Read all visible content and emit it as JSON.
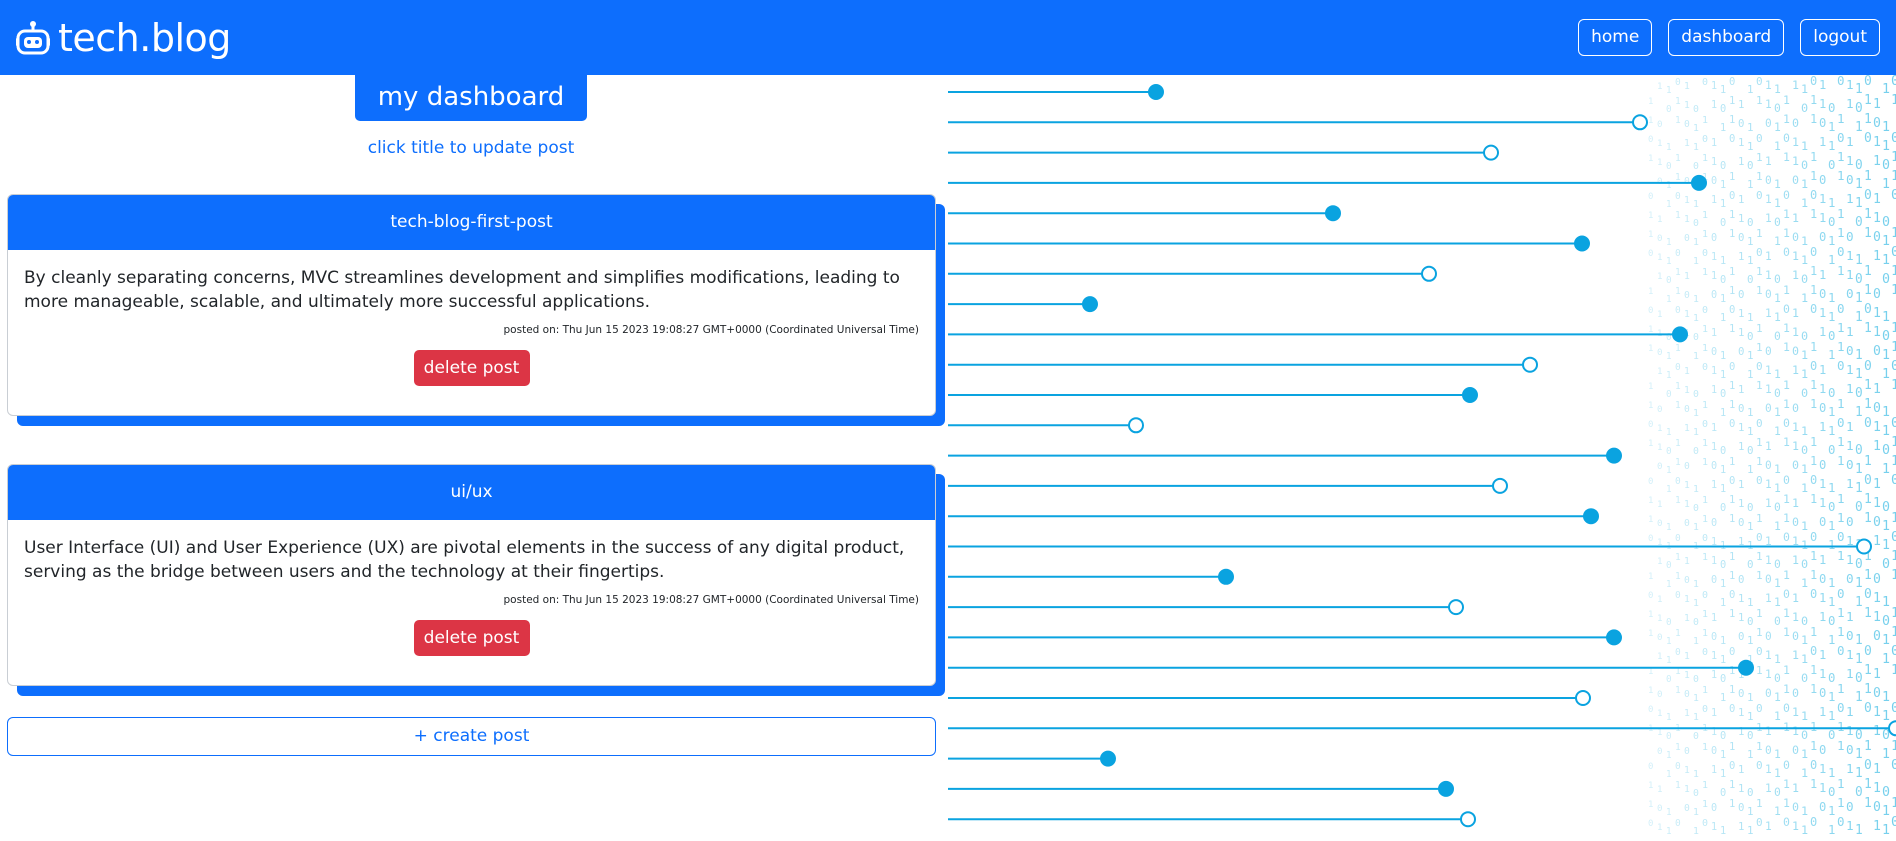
{
  "navbar": {
    "brand": "tech.blog",
    "links": [
      "home",
      "dashboard",
      "logout"
    ]
  },
  "dashboard": {
    "title": "my dashboard",
    "subtitle": "click title to update post"
  },
  "posts": [
    {
      "title": "tech-blog-first-post",
      "body": "By cleanly separating concerns, MVC streamlines development and simplifies modifications, leading to more manageable, scalable, and ultimately more successful applications.",
      "posted": "posted on: Thu Jun 15 2023 19:08:27 GMT+0000 (Coordinated Universal Time)",
      "delete_label": "delete post"
    },
    {
      "title": "ui/ux",
      "body": "User Interface (UI) and User Experience (UX) are pivotal elements in the success of any digital product, serving as the bridge between users and the technology at their fingertips.",
      "posted": "posted on: Thu Jun 15 2023 19:08:27 GMT+0000 (Coordinated Universal Time)",
      "delete_label": "delete post"
    }
  ],
  "create_label": "+ create post",
  "colors": {
    "primary": "#0d6efd",
    "danger": "#dc3545",
    "decor_line": "#0aa3e0"
  },
  "icons": [
    "robot-icon"
  ]
}
